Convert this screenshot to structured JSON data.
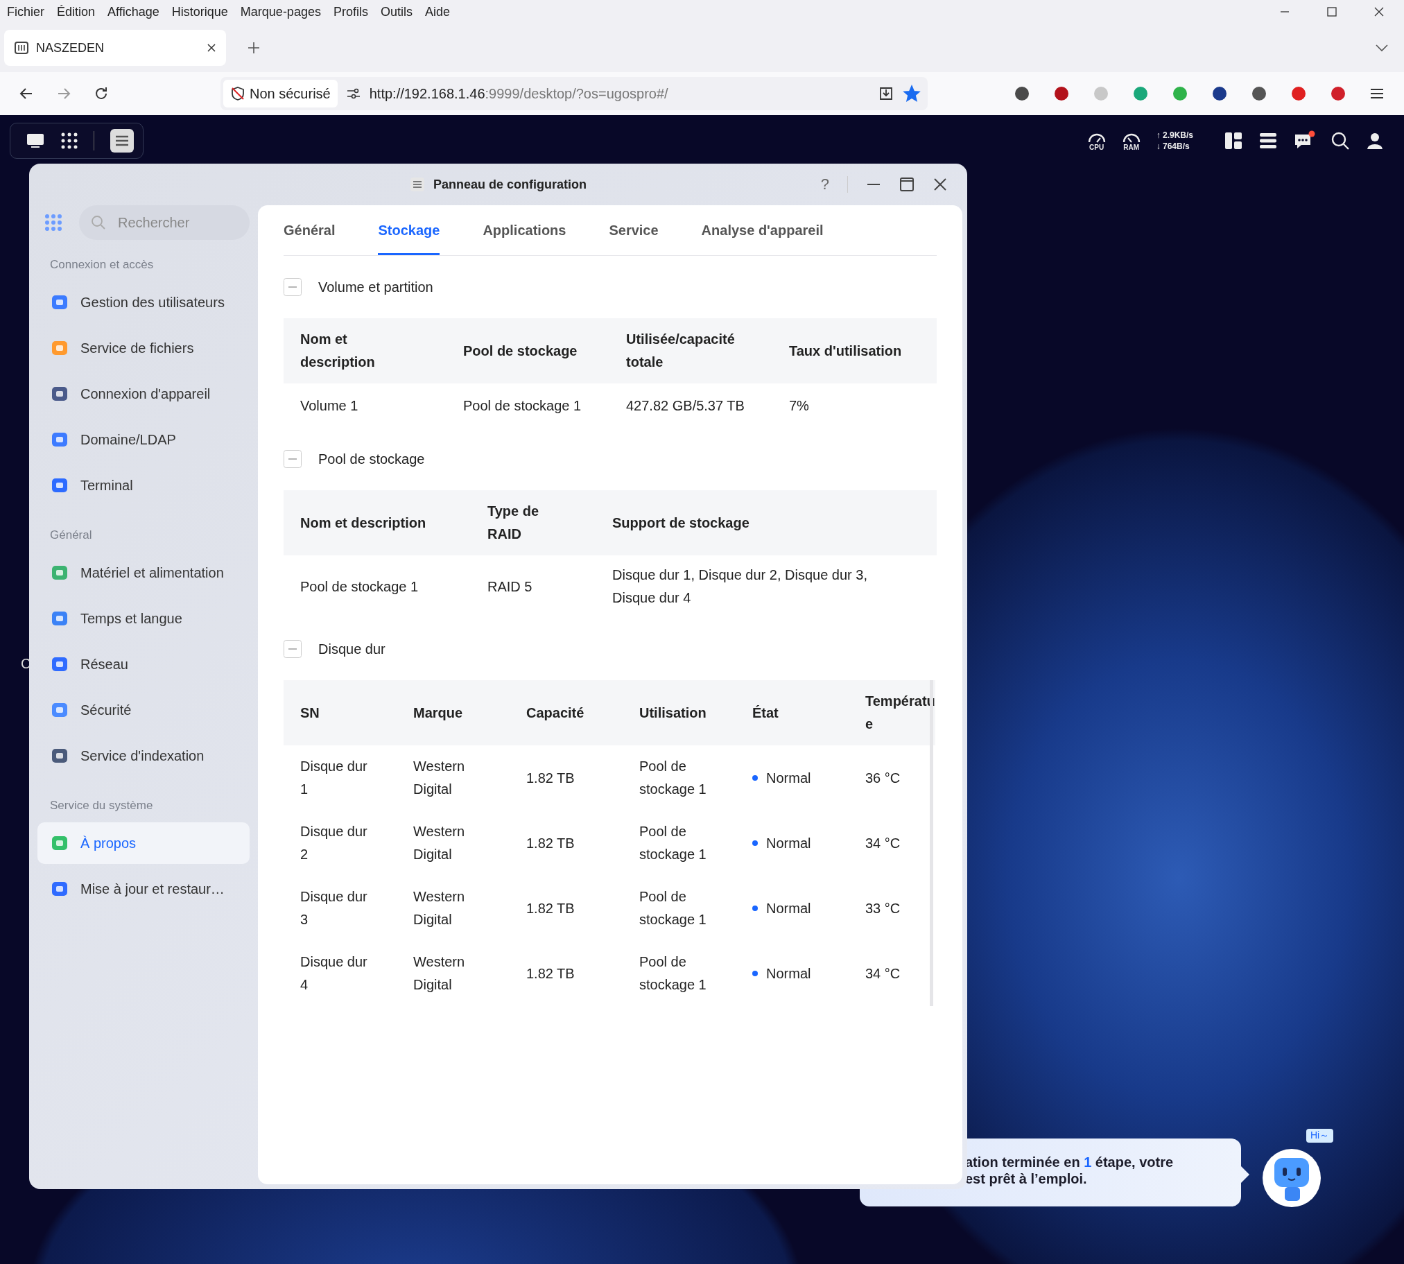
{
  "menu_bar": [
    "Fichier",
    "Édition",
    "Affichage",
    "Historique",
    "Marque-pages",
    "Profils",
    "Outils",
    "Aide"
  ],
  "browser_tab": {
    "title": "NASZEDEN",
    "selected": true
  },
  "address_bar": {
    "security": "Non sécurisé",
    "url_host": "http://192.168.1.46",
    "url_rest": ":9999/desktop/?os=ugospro#/",
    "bookmarked": true
  },
  "top_bar": {
    "cpu_label": "CPU",
    "ram_label": "RAM",
    "upload": "↑ 2.9KB/s",
    "download": "↓ 764B/s",
    "notification": true
  },
  "desktop_label": "C",
  "window": {
    "title": "Panneau de configuration",
    "help": "?"
  },
  "sidebar": {
    "search": {
      "placeholder": "Rechercher"
    },
    "groups": [
      {
        "title": "Connexion et accès",
        "items": [
          {
            "label": "Gestion des utilisateurs",
            "selected": false
          },
          {
            "label": "Service de fichiers",
            "selected": false
          },
          {
            "label": "Connexion d'appareil",
            "selected": false
          },
          {
            "label": "Domaine/LDAP",
            "selected": false
          },
          {
            "label": "Terminal",
            "selected": false
          }
        ]
      },
      {
        "title": "Général",
        "items": [
          {
            "label": "Matériel et alimentation",
            "selected": false
          },
          {
            "label": "Temps et langue",
            "selected": false
          },
          {
            "label": "Réseau",
            "selected": false
          },
          {
            "label": "Sécurité",
            "selected": false
          },
          {
            "label": "Service d'indexation",
            "selected": false
          }
        ]
      },
      {
        "title": "Service du système",
        "items": [
          {
            "label": "À propos",
            "selected": true
          },
          {
            "label": "Mise à jour et restaur…",
            "selected": false
          }
        ]
      }
    ]
  },
  "tabs": [
    {
      "label": "Général",
      "selected": false
    },
    {
      "label": "Stockage",
      "selected": true
    },
    {
      "label": "Applications",
      "selected": false
    },
    {
      "label": "Service",
      "selected": false
    },
    {
      "label": "Analyse d'appareil",
      "selected": false
    }
  ],
  "sections": [
    {
      "title": "Volume et partition",
      "expanded": true,
      "kind": "volume",
      "table": {
        "columns": [
          "Nom et\ndescription",
          "Pool de stockage",
          "Utilisée/capacité\ntotale",
          "Taux d'utilisation"
        ],
        "rows": [
          [
            "Volume 1",
            "Pool de stockage 1",
            "427.82 GB/5.37 TB",
            "7%"
          ]
        ]
      }
    },
    {
      "title": "Pool de stockage",
      "expanded": true,
      "kind": "pool",
      "table": {
        "columns": [
          "Nom et description",
          "Type de\nRAID",
          "Support de stockage"
        ],
        "rows": [
          [
            "Pool de stockage 1",
            "RAID 5",
            "Disque dur 1, Disque dur 2, Disque dur 3,\nDisque dur 4"
          ]
        ]
      }
    },
    {
      "title": "Disque dur",
      "expanded": true,
      "kind": "disk",
      "table": {
        "columns": [
          "SN",
          "Marque",
          "Capacité",
          "Utilisation",
          "État",
          "Températu\ne"
        ],
        "rows": [
          {
            "sn": "Disque dur\n1",
            "brand": "Western\nDigital",
            "capacity": "1.82 TB",
            "usage": "Pool de\nstockage 1",
            "state": "Normal",
            "color": "#1a66ff",
            "temp": "36 °C"
          },
          {
            "sn": "Disque dur\n2",
            "brand": "Western\nDigital",
            "capacity": "1.82 TB",
            "usage": "Pool de\nstockage 1",
            "state": "Normal",
            "color": "#1a66ff",
            "temp": "34 °C"
          },
          {
            "sn": "Disque dur\n3",
            "brand": "Western\nDigital",
            "capacity": "1.82 TB",
            "usage": "Pool de\nstockage 1",
            "state": "Normal",
            "color": "#1a66ff",
            "temp": "33 °C"
          },
          {
            "sn": "Disque dur\n4",
            "brand": "Western\nDigital",
            "capacity": "1.82 TB",
            "usage": "Pool de\nstockage 1",
            "state": "Normal",
            "color": "#1a66ff",
            "temp": "34 °C"
          }
        ]
      }
    }
  ],
  "assistant": {
    "line1_start": "ation terminée en",
    "highlight": "1",
    "line1_end": "étape, votre",
    "line2": "est prêt à l’emploi.",
    "greeting": "Hi～"
  }
}
